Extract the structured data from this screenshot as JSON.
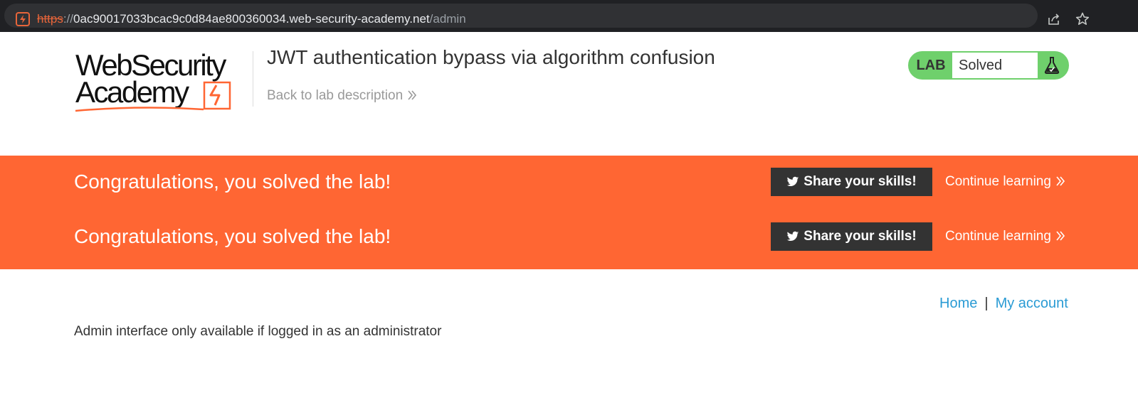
{
  "browser": {
    "url_scheme": "https",
    "url_separator": "://",
    "url_host": "0ac90017033bcac9c0d84ae800360034.web-security-academy.net",
    "url_path": "/admin"
  },
  "header": {
    "logo": {
      "line1": "WebSecurity",
      "line2": "Academy"
    },
    "title": "JWT authentication bypass via algorithm confusion",
    "back_link": "Back to lab description",
    "lab_badge": {
      "label": "LAB",
      "status": "Solved"
    }
  },
  "banner": {
    "rows": [
      {
        "message": "Congratulations, you solved the lab!",
        "share": "Share your skills!",
        "continue": "Continue learning"
      },
      {
        "message": "Congratulations, you solved the lab!",
        "share": "Share your skills!",
        "continue": "Continue learning"
      }
    ]
  },
  "nav": {
    "home": "Home",
    "separator": "|",
    "account": "My account"
  },
  "content": {
    "message": "Admin interface only available if logged in as an administrator"
  },
  "colors": {
    "accent": "#ff6633",
    "solved_green": "#6fd06c",
    "link_blue": "#2a9bd4",
    "text": "#333333"
  },
  "icons": [
    "lightning-site-icon",
    "share-page-icon",
    "bookmark-star-icon",
    "flask-icon",
    "twitter-icon",
    "double-chevron-right-icon"
  ]
}
